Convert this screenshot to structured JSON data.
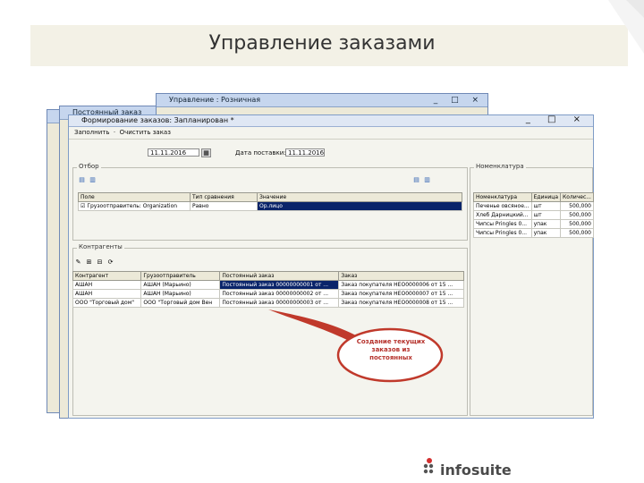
{
  "slide": {
    "title": "Управление заказами"
  },
  "back_windows": [
    {
      "title": "Постоянный заказ"
    },
    {
      "title": "Управление : Розничная"
    }
  ],
  "main": {
    "title": "Формирование заказов: Запланирован *",
    "toolbar": [
      "Заполнить",
      "Очистить заказ"
    ],
    "date_label": "",
    "date_value": "11.11.2016",
    "delivery_label": "Дата поставки:",
    "delivery_value": "11.11.2016",
    "filter_group": "Отбор",
    "filter_table": {
      "headers": [
        "Поле",
        "Тип сравнения",
        "Значение"
      ],
      "rows": [
        [
          "Грузоотправитель: Organization",
          "Равно",
          "Ор.лицо"
        ]
      ]
    },
    "nomenclature_group": "Номенклатура",
    "nomenclature_table": {
      "headers": [
        "Номенклатура",
        "Единица",
        "Количес..."
      ],
      "rows": [
        [
          "Печенье овсяное...",
          "шт",
          "500,000"
        ],
        [
          "Хлеб Дарницкий...",
          "шт",
          "500,000"
        ],
        [
          "Чипсы Pringles 0...",
          "упак",
          "500,000"
        ],
        [
          "Чипсы Pringles 0...",
          "упак",
          "500,000"
        ]
      ]
    },
    "contractors_group": "Контрагенты",
    "contractors_table": {
      "headers": [
        "Контрагент",
        "Грузоотправитель",
        "Постоянный заказ",
        "Заказ"
      ],
      "rows": [
        [
          "АШАН",
          "АШАН (Марьино)",
          "Постоянный заказ 00000000001 от ...",
          "Заказ покупателя НЕО0000006 от 15 ..."
        ],
        [
          "АШАН",
          "АШАН (Марьино)",
          "Постоянный заказ 00000000002 от ...",
          "Заказ покупателя НЕО0000007 от 15 ..."
        ],
        [
          "ООО \"Торговый дом\"",
          "ООО \"Торговый дом Вен",
          "Постоянный заказ 00000000003 от ...",
          "Заказ покупателя НЕО0000008 от 15 ..."
        ]
      ]
    }
  },
  "callout": {
    "text": "Создание текущих заказов из постоянных"
  },
  "logo": {
    "text": "infosuite"
  },
  "colors": {
    "selection": "#0a246a",
    "callout_red": "#c0392b",
    "logo_red": "#d32f2f"
  }
}
